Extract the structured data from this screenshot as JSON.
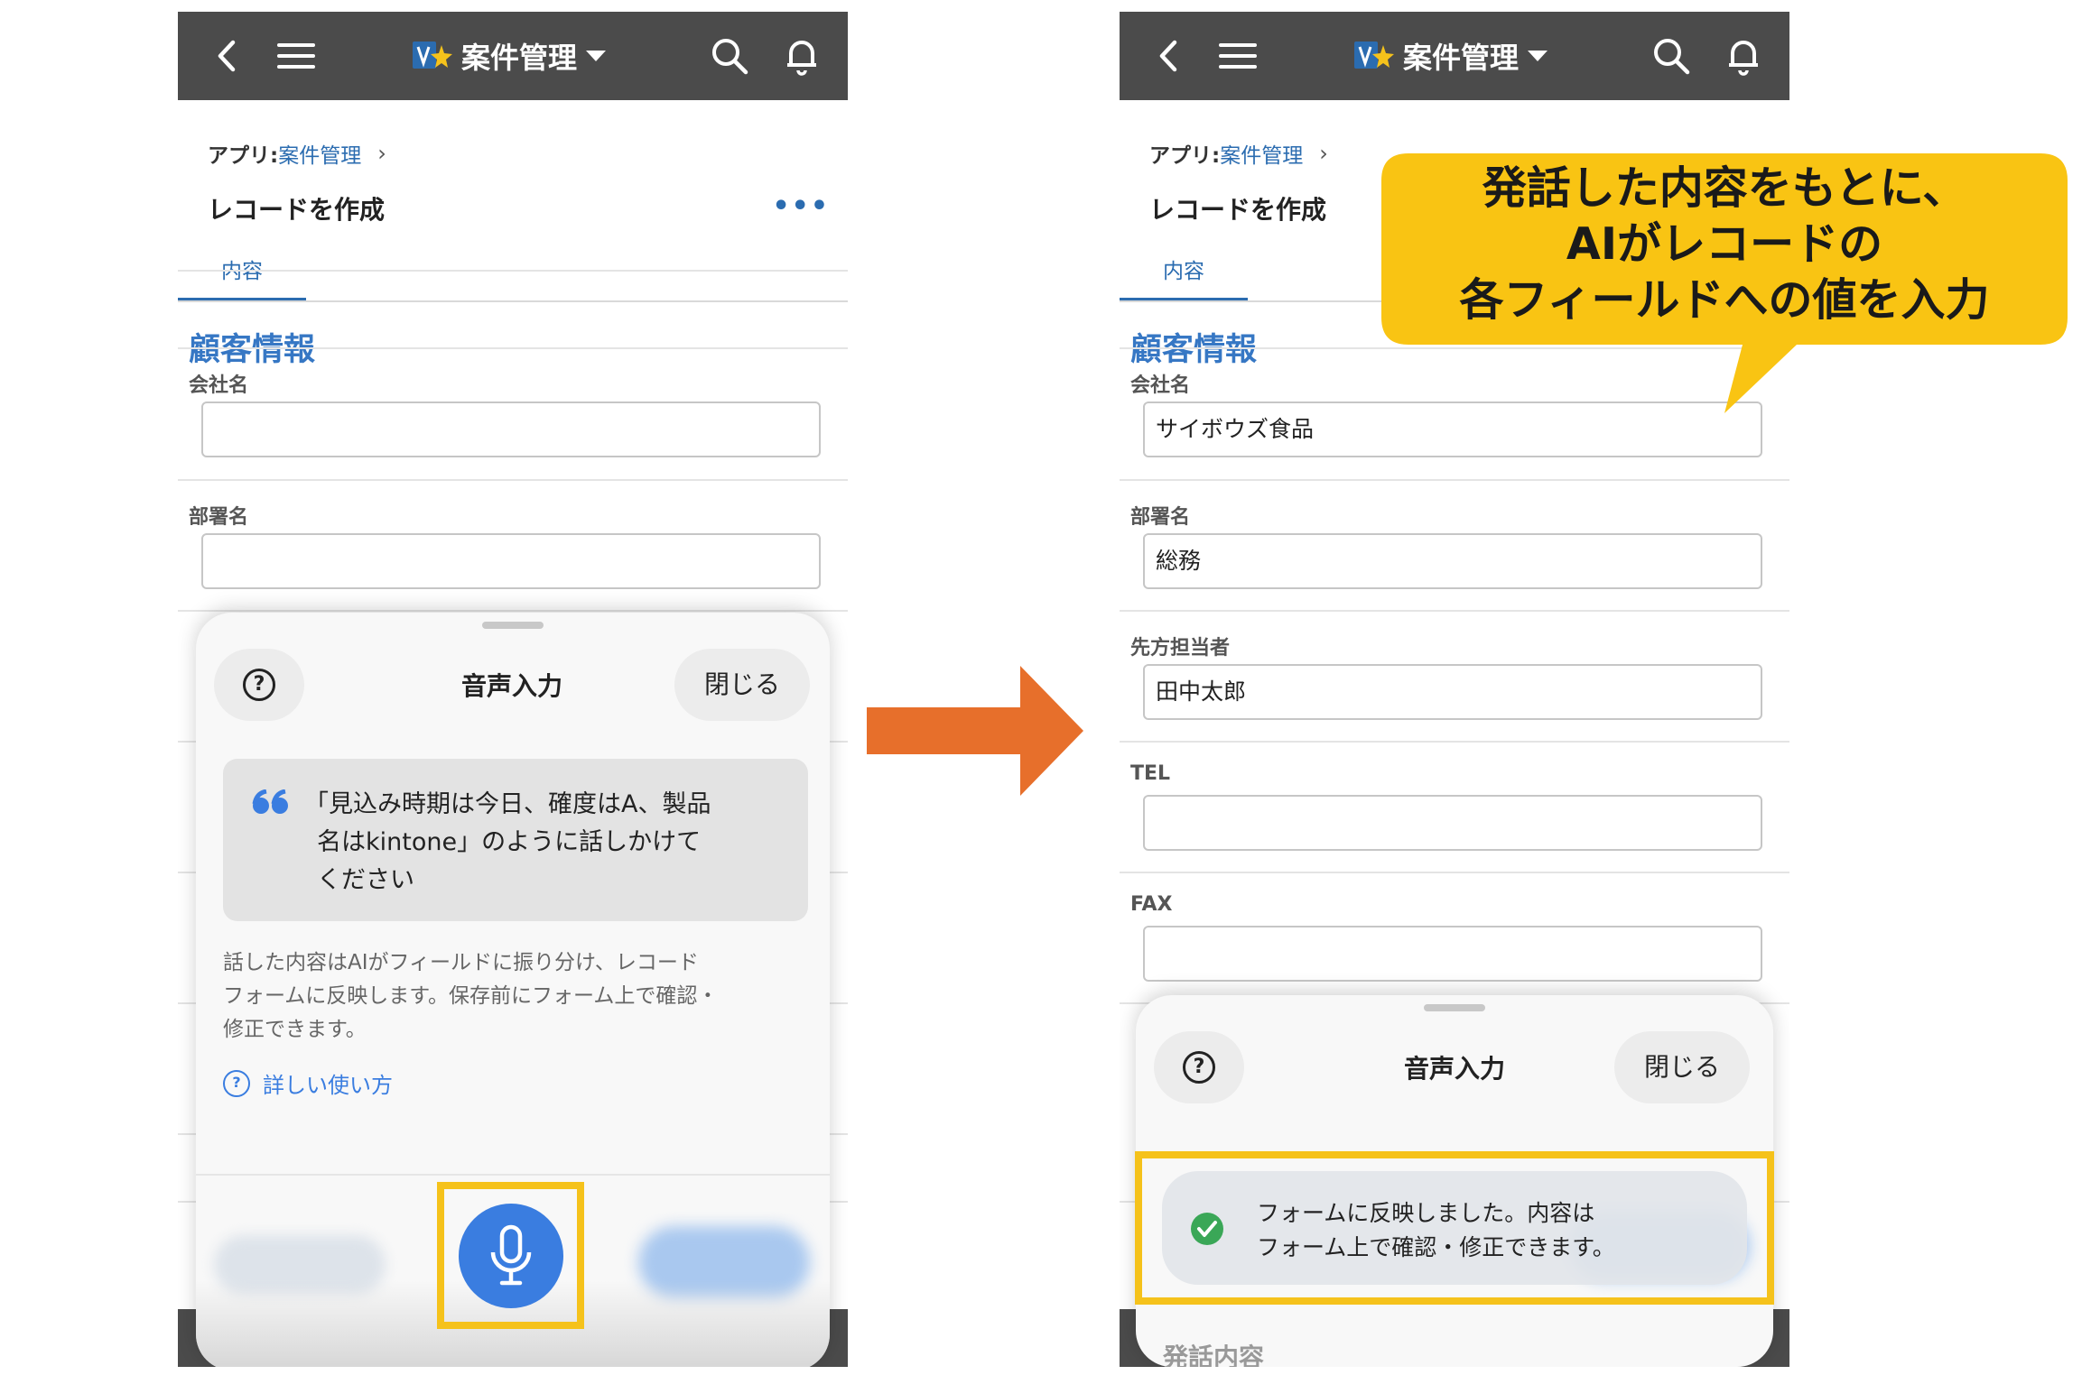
{
  "app": {
    "title": "案件管理",
    "breadcrumb_prefix": "アプリ: ",
    "breadcrumb_link": "案件管理",
    "record_title": "レコードを作成",
    "tab_label": "内容",
    "section_title": "顧客情報"
  },
  "left_panel": {
    "fields": [
      {
        "label": "会社名",
        "value": ""
      },
      {
        "label": "部署名",
        "value": ""
      }
    ],
    "sheet": {
      "title": "音声入力",
      "close_label": "閉じる",
      "quote_lines": [
        "「見込み時期は今日、確度はA、製品",
        "名はkintone」のように話しかけて",
        "ください"
      ],
      "description_lines": [
        "話した内容はAIがフィールドに振り分け、レコード",
        "フォームに反映します。保存前にフォーム上で確認・",
        "修正できます。"
      ],
      "help_link": "詳しい使い方"
    }
  },
  "right_panel": {
    "fields": [
      {
        "label": "会社名",
        "value": "サイボウズ食品"
      },
      {
        "label": "部署名",
        "value": "総務"
      },
      {
        "label": "先方担当者",
        "value": "田中太郎"
      },
      {
        "label": "TEL",
        "value": ""
      },
      {
        "label": "FAX",
        "value": ""
      }
    ],
    "sheet": {
      "title": "音声入力",
      "close_label": "閉じる",
      "toast_lines": [
        "フォームに反映しました。内容は",
        "フォーム上で確認・修正できます。"
      ],
      "partial_label": "発話内容"
    }
  },
  "callout": {
    "lines": [
      "発話した内容をもとに、",
      "AIがレコードの",
      "各フィールドへの値を入力"
    ]
  },
  "colors": {
    "topbar": "#4b4b4b",
    "link_blue": "#2b6cb0",
    "mic_blue": "#3a7de0",
    "highlight_yellow": "#f5c21b",
    "callout_yellow": "#f9c413",
    "arrow_orange": "#e76f2b",
    "success_green": "#3aa757"
  }
}
